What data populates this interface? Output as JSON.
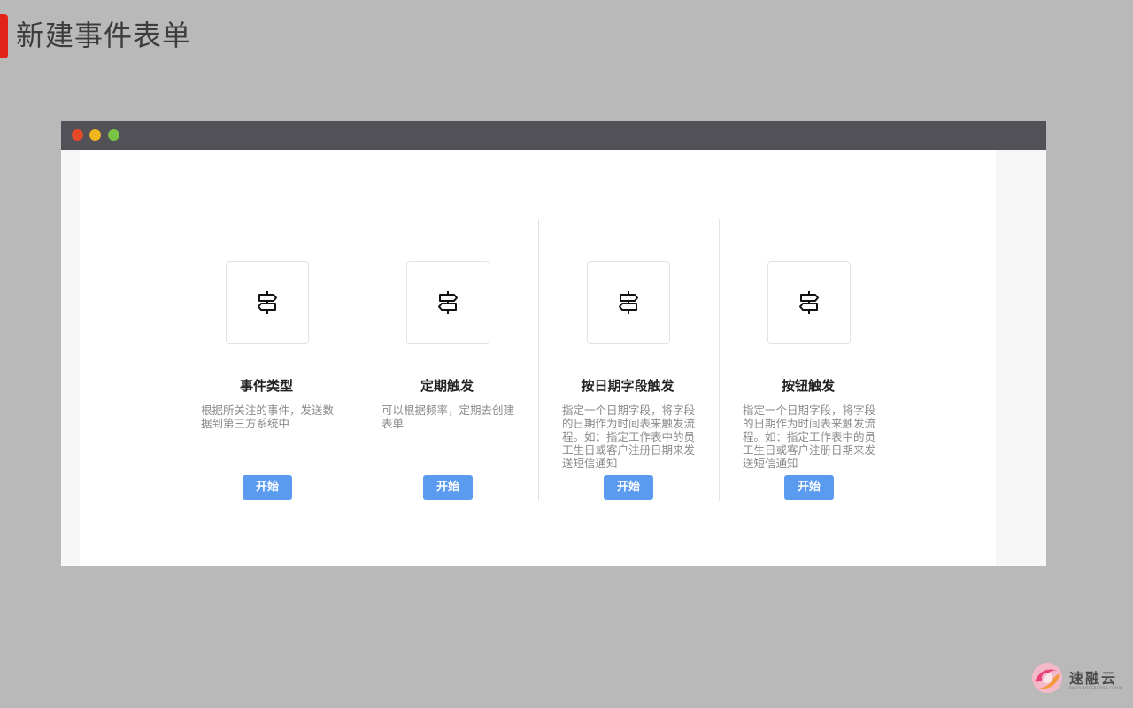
{
  "slide": {
    "title": "新建事件表单"
  },
  "window": {
    "controls": [
      "close",
      "minimize",
      "maximize"
    ]
  },
  "cards": [
    {
      "icon": "signpost-icon",
      "title": "事件类型",
      "description": "根据所关注的事件，发送数据到第三方系统中",
      "button": "开始"
    },
    {
      "icon": "signpost-icon",
      "title": "定期触发",
      "description": "可以根据频率，定期去创建表单",
      "button": "开始"
    },
    {
      "icon": "signpost-icon",
      "title": "按日期字段触发",
      "description": "指定一个日期字段，将字段的日期作为时间表来触发流程。如：指定工作表中的员工生日或客户注册日期来发送短信通知",
      "button": "开始"
    },
    {
      "icon": "signpost-icon",
      "title": "按钮触发",
      "description": "指定一个日期字段，将字段的日期作为时间表来触发流程。如：指定工作表中的员工生日或客户注册日期来发送短信通知",
      "button": "开始"
    }
  ],
  "brand": {
    "name": "速融云",
    "tagline": "RAPID INTEGRATION CLOUD",
    "accent_color": "#e2231a",
    "button_color": "#5a9bf0"
  }
}
